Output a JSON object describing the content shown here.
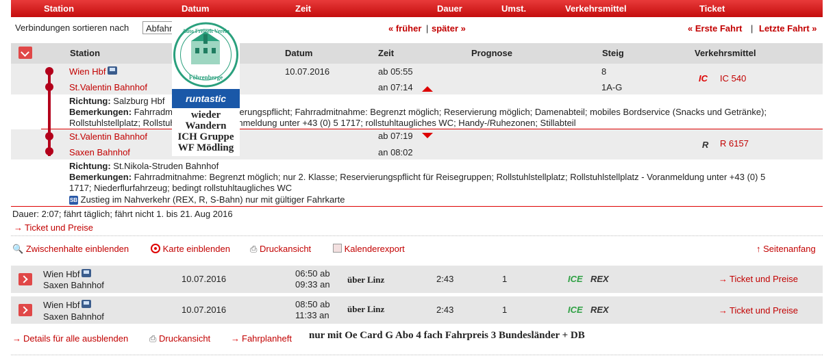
{
  "topbar": {
    "station": "Station",
    "datum": "Datum",
    "zeit": "Zeit",
    "dauer": "Dauer",
    "umst": "Umst.",
    "verkehrsmittel": "Verkehrsmittel",
    "ticket": "Ticket"
  },
  "sort": {
    "label": "Verbindungen sortieren nach",
    "value": "Abfahrt"
  },
  "nav": {
    "frueher": "« früher",
    "sep": "|",
    "spaeter": "später »",
    "erste": "« Erste Fahrt",
    "letzte": "Letzte Fahrt »"
  },
  "detail_header": {
    "station": "Station",
    "datum": "Datum",
    "zeit": "Zeit",
    "prognose": "Prognose",
    "steig": "Steig",
    "verkehrsmittel": "Verkehrsmittel"
  },
  "leg1": {
    "from": "Wien Hbf",
    "to": "St.Valentin Bahnhof",
    "date": "10.07.2016",
    "dep": "ab 05:55",
    "arr": "an 07:14",
    "steig_dep": "8",
    "steig_arr": "1A-G",
    "train_logo": "IC",
    "train": "IC 540",
    "richtung_label": "Richtung:",
    "richtung": "Salzburg Hbf",
    "bemerkungen_label": "Bemerkungen:",
    "bem_line1": "Fahrradmitnahme: Reservierungspflicht; Fahrradmitnahme: Begrenzt möglich; Reservierung möglich; Damenabteil; mobiles Bordservice (Snacks und Getränke);",
    "bem_line2": "Rollstuhlstellplatz; Rollstuhlstellplatz - Voranmeldung unter +43 (0) 5 1717; rollstuhltaugliches WC; Handy-/Ruhezonen; Stillabteil"
  },
  "leg2": {
    "from": "St.Valentin Bahnhof",
    "to": "Saxen Bahnhof",
    "dep": "ab 07:19",
    "arr": "an 08:02",
    "train_logo": "R",
    "train": "R 6157",
    "richtung_label": "Richtung:",
    "richtung": "St.Nikola-Struden Bahnhof",
    "bemerkungen_label": "Bemerkungen:",
    "bem_line1": "Fahrradmitnahme: Begrenzt möglich; nur 2. Klasse; Reservierungspflicht für Reisegruppen; Rollstuhlstellplatz; Rollstuhlstellplatz - Voranmeldung unter +43 (0) 5",
    "bem_line2": "1717; Niederflurfahrzeug; bedingt rollstuhltaugliches WC",
    "sb_icon": "SB",
    "zustieg": "Zustieg im Nahverkehr (REX, R, S-Bahn) nur mit gültiger Fahrkarte"
  },
  "summary": {
    "dauer": "Dauer: 2:07; fährt täglich; fährt nicht 1. bis 21. Aug 2016",
    "ticket": "Ticket und Preise"
  },
  "tools": {
    "zwischenhalte": "Zwischenhalte einblenden",
    "karte": "Karte einblenden",
    "druck": "Druckansicht",
    "kalender": "Kalenderexport",
    "seitenanfang": "Seitenanfang"
  },
  "connections": [
    {
      "from": "Wien Hbf",
      "to": "Saxen Bahnhof",
      "date": "10.07.2016",
      "dep": "06:50 ab",
      "arr": "09:33 an",
      "via": "über Linz",
      "duration": "2:43",
      "changes": "1",
      "train1": "ICE",
      "train2": "REX",
      "ticket": "Ticket und Preise"
    },
    {
      "from": "Wien Hbf",
      "to": "Saxen Bahnhof",
      "date": "10.07.2016",
      "dep": "08:50 ab",
      "arr": "11:33 an",
      "via": "über Linz",
      "duration": "2:43",
      "changes": "1",
      "train1": "ICE",
      "train2": "REX",
      "ticket": "Ticket und Preise"
    }
  ],
  "bottom": {
    "details": "Details für alle ausblenden",
    "druck": "Druckansicht",
    "fahrplanheft": "Fahrplanheft",
    "note": "nur mit Oe Card G Abo 4 fach Fahrpreis 3 Bundesländer + DB"
  },
  "overlay": {
    "stamp_top": "Auto Freizeit Verein",
    "stamp_bottom": "Föhrenberge",
    "runtastic": "runtastic",
    "line1": "wieder",
    "line2": "Wandern",
    "line3": "ICH Gruppe",
    "line4": "WF Mödling"
  },
  "colors": {
    "accent": "#d00000",
    "link": "#c20000",
    "band": "#ececec",
    "header": "#dcdcdc"
  }
}
